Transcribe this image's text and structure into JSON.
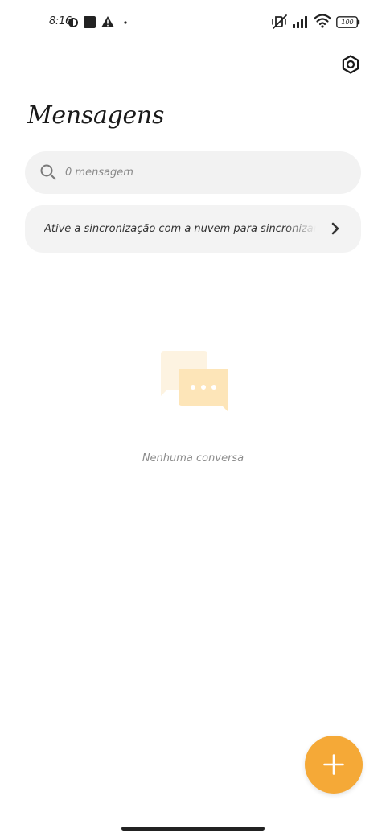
{
  "status_bar": {
    "time": "8:16",
    "battery_level": "100",
    "icons": [
      "data-saver-icon",
      "square-notification-icon",
      "warning-icon",
      "dot-icon",
      "mute-vibrate-icon",
      "signal-icon",
      "wifi-icon",
      "battery-icon"
    ]
  },
  "header": {
    "title": "Mensagens",
    "settings_icon": "settings-hexagon-icon"
  },
  "search": {
    "placeholder": "0 mensagem",
    "value": "",
    "icon": "search-icon"
  },
  "sync_banner": {
    "text": "Ative a sincronização com a nuvem para sincronizar mensagens",
    "icon": "chevron-right-icon"
  },
  "empty_state": {
    "icon": "chat-bubbles-icon",
    "label": "Nenhuma conversa"
  },
  "fab": {
    "icon": "plus-icon",
    "color": "#f5a937"
  },
  "colors": {
    "accent": "#f5a937",
    "bubble_light": "#fdf3e1",
    "bubble_mid": "#fde5b8",
    "surface": "#f2f2f2"
  }
}
